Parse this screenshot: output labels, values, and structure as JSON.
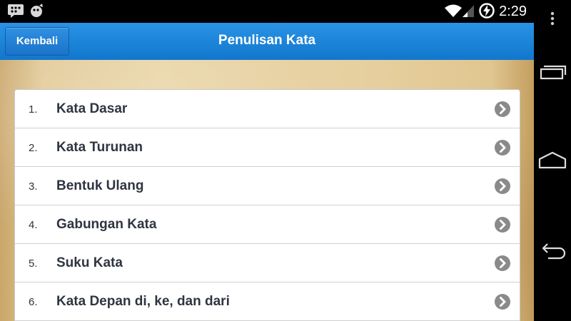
{
  "status_bar": {
    "time": "2:29",
    "icons": [
      "bbm-icon",
      "notification-app-icon",
      "wifi-icon",
      "signal-icon",
      "charging-battery-icon"
    ]
  },
  "action_bar": {
    "back_label": "Kembali",
    "title": "Penulisan Kata",
    "color": "#1a85d9"
  },
  "menu": {
    "items": [
      {
        "number": "1.",
        "label": "Kata Dasar"
      },
      {
        "number": "2.",
        "label": "Kata Turunan"
      },
      {
        "number": "3.",
        "label": "Bentuk Ulang"
      },
      {
        "number": "4.",
        "label": "Gabungan Kata"
      },
      {
        "number": "5.",
        "label": "Suku Kata"
      },
      {
        "number": "6.",
        "label": "Kata Depan di, ke, dan dari"
      }
    ]
  },
  "nav_bar": {
    "icons": [
      "overflow-menu-icon",
      "recent-apps-icon",
      "home-icon",
      "back-icon"
    ]
  }
}
